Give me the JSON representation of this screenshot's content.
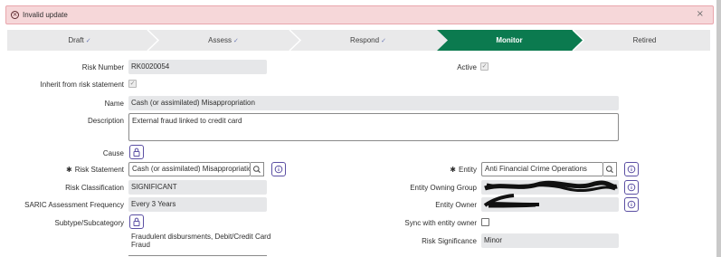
{
  "alert": {
    "icon": "error-circle-icon",
    "message": "Invalid update",
    "close_icon": "close-icon"
  },
  "stepper": {
    "steps": [
      {
        "label": "Draft",
        "done": true
      },
      {
        "label": "Assess",
        "done": true
      },
      {
        "label": "Respond",
        "done": true
      },
      {
        "label": "Monitor",
        "done": false,
        "active": true
      },
      {
        "label": "Retired",
        "done": false
      }
    ],
    "check_glyph": "✓",
    "active_color": "#0b7a4f",
    "inactive_color": "#e9e9ea"
  },
  "form": {
    "risk_number": {
      "label": "Risk Number",
      "value": "RK0020054"
    },
    "active": {
      "label": "Active",
      "checked": true
    },
    "inherit": {
      "label": "Inherit from risk statement",
      "checked": true
    },
    "name": {
      "label": "Name",
      "value": "Cash (or assimilated) Misappropriation"
    },
    "description": {
      "label": "Description",
      "value": "External fraud linked to credit card"
    },
    "cause": {
      "label": "Cause"
    },
    "risk_statement": {
      "label": "Risk Statement",
      "value": "Cash (or assimilated) Misappropriation"
    },
    "entity": {
      "label": "Entity",
      "value": "Anti Financial Crime Operations"
    },
    "risk_classification": {
      "label": "Risk Classification",
      "value": "SIGNIFICANT"
    },
    "entity_owning_group": {
      "label": "Entity Owning Group",
      "value": ""
    },
    "saric": {
      "label": "SARIC Assessment Frequency",
      "value": "Every 3 Years"
    },
    "entity_owner": {
      "label": "Entity Owner",
      "value": ""
    },
    "subtype": {
      "label": "Subtype/Subcategory",
      "value_line1": "Fraudulent disbursments, Debit/Credit Card",
      "value_line2": "Fraud"
    },
    "sync": {
      "label": "Sync with entity owner",
      "checked": false
    },
    "risk_significance": {
      "label": "Risk Significance",
      "value": "Minor"
    },
    "required_marker": "✱",
    "check_glyph": "✓"
  },
  "colors": {
    "accent": "#5b4fa3",
    "alert_bg": "#f6d7d9",
    "field_bg": "#e6e7e9"
  }
}
